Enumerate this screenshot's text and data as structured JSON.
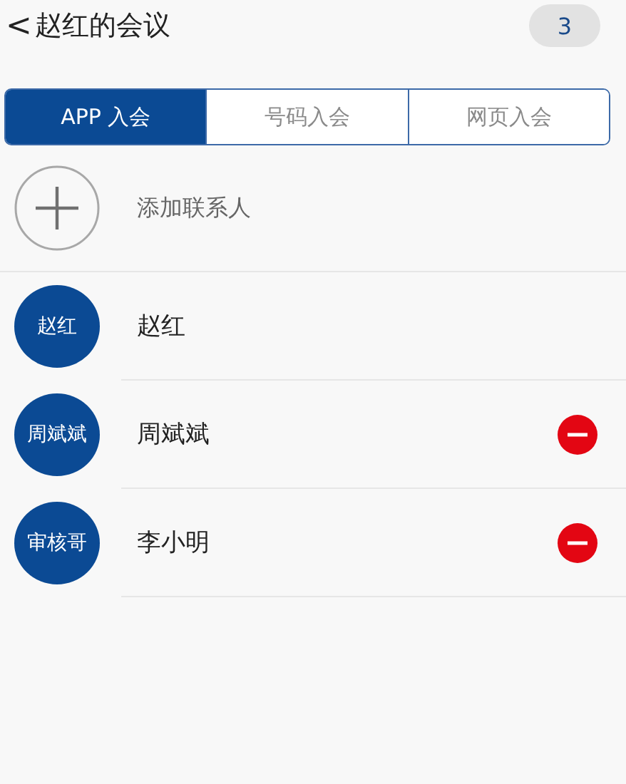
{
  "header": {
    "back": "<",
    "title": "赵红的会议",
    "count": "3"
  },
  "tabs": [
    {
      "label": "APP 入会",
      "selected": true
    },
    {
      "label": "号码入会",
      "selected": false
    },
    {
      "label": "网页入会",
      "selected": false
    }
  ],
  "add_contact": {
    "label": "添加联系人"
  },
  "participants": [
    {
      "avatar": "赵红",
      "name": "赵红",
      "removable": false
    },
    {
      "avatar": "周斌斌",
      "name": "周斌斌",
      "removable": true
    },
    {
      "avatar": "审核哥",
      "name": "李小明",
      "removable": true
    }
  ]
}
